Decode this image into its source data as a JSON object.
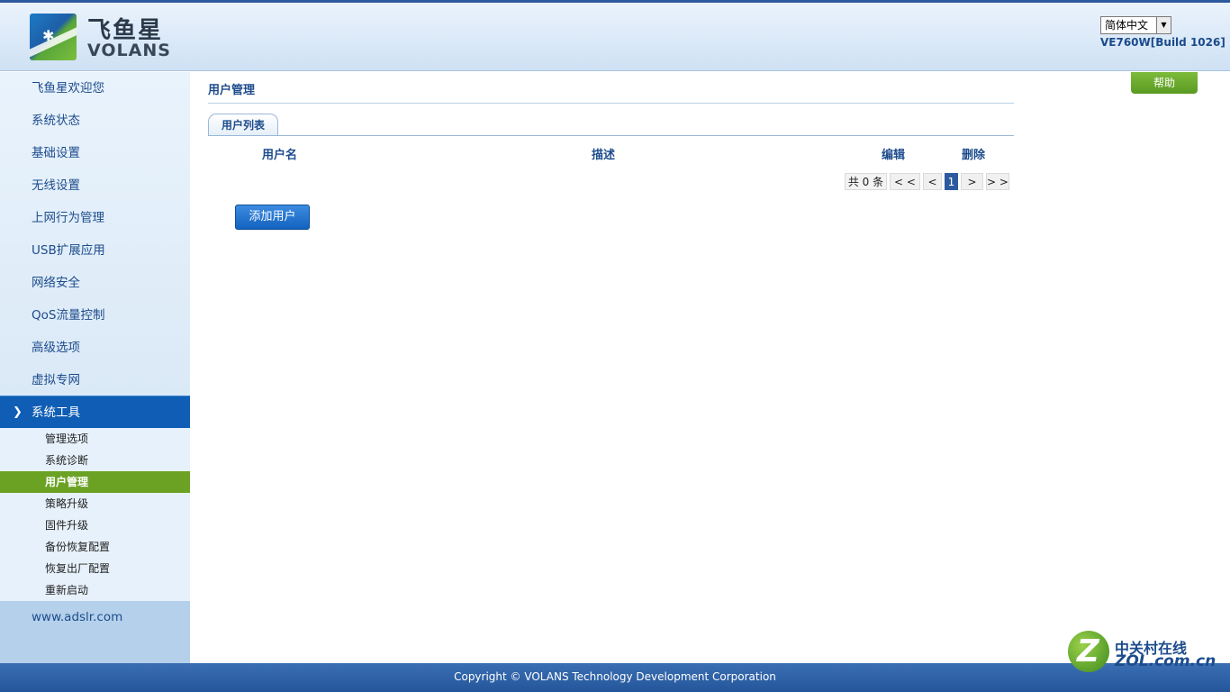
{
  "header": {
    "logo_cn": "飞鱼星",
    "logo_en": "VOLANS",
    "language": "简体中文",
    "build": "VE760W[Build 1026]"
  },
  "sidebar": {
    "items": [
      {
        "label": "飞鱼星欢迎您"
      },
      {
        "label": "系统状态"
      },
      {
        "label": "基础设置"
      },
      {
        "label": "无线设置"
      },
      {
        "label": "上网行为管理"
      },
      {
        "label": "USB扩展应用"
      },
      {
        "label": "网络安全"
      },
      {
        "label": "QoS流量控制"
      },
      {
        "label": "高级选项"
      },
      {
        "label": "虚拟专网"
      }
    ],
    "active": {
      "label": "系统工具"
    },
    "subitems": [
      {
        "label": "管理选项"
      },
      {
        "label": "系统诊断"
      },
      {
        "label": "用户管理"
      },
      {
        "label": "策略升级"
      },
      {
        "label": "固件升级"
      },
      {
        "label": "备份恢复配置"
      },
      {
        "label": "恢复出厂配置"
      },
      {
        "label": "重新启动"
      }
    ],
    "selected_subitem": "用户管理",
    "site": "www.adslr.com"
  },
  "main": {
    "title": "用户管理",
    "help": "帮助",
    "tab": "用户列表",
    "columns": [
      "用户名",
      "描述",
      "编辑",
      "删除"
    ],
    "pagination": {
      "total": "共 0 条",
      "first": "< <",
      "prev": "<",
      "page": "1",
      "next": ">",
      "last": "> >"
    },
    "add_button": "添加用户"
  },
  "footer": {
    "copyright": "Copyright © VOLANS Technology Development Corporation"
  },
  "watermark": {
    "cn": "中关村在线",
    "en": "ZOL.com.cn"
  }
}
